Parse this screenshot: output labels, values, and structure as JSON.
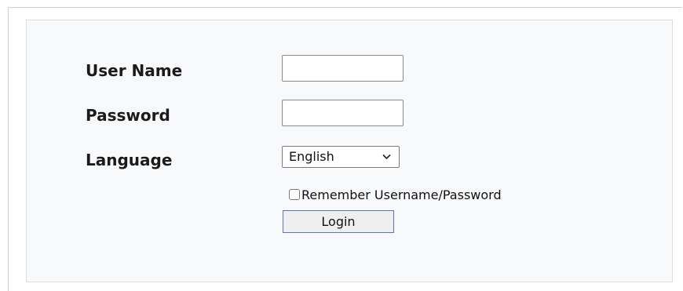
{
  "form": {
    "username_label": "User Name",
    "username_value": "",
    "password_label": "Password",
    "password_value": "",
    "language_label": "Language",
    "language_selected": "English",
    "remember_label": "Remember Username/Password",
    "remember_checked": false,
    "login_label": "Login"
  },
  "icons": {
    "select_arrow": "chevron-down-icon",
    "checkbox": "checkbox-icon"
  },
  "colors": {
    "panel_background": "#f8f9fb",
    "panel_border": "#d9dde2",
    "button_border": "#5a76b8",
    "button_background": "#efefef"
  }
}
